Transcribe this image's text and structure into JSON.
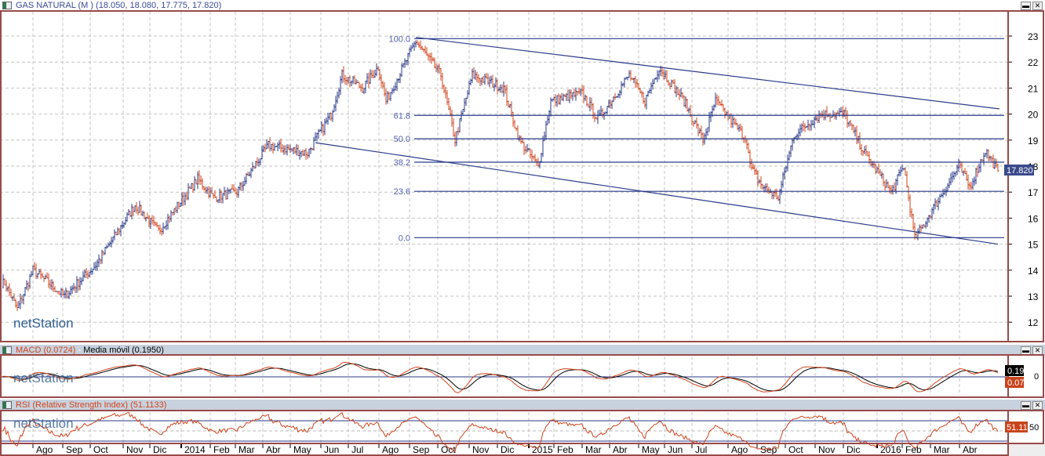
{
  "main": {
    "title": "GAS NATURAL (M ) (18.050, 18.080, 17.775, 17.820)",
    "last_price": "17.820",
    "watermark": "netStation"
  },
  "macd": {
    "title": "MACD (0.0724)",
    "sep": " - ",
    "ma_title": "Media móvil (0.1950)",
    "value1": "0.19",
    "value2": "0.07",
    "axis_label": "0"
  },
  "rsi": {
    "title": "RSI (Relative Strength Index) (51.1133)",
    "value": "51.11",
    "axis_label": "50"
  },
  "window_buttons": {
    "minimize": "▬",
    "close": "✕"
  },
  "colors": {
    "up": "#2a3a8a",
    "down": "#d0441c",
    "line": "#2a3a8a",
    "frame": "#9a4a4a"
  },
  "chart_data": {
    "type": "ohlc",
    "instrument": "GAS NATURAL",
    "last": {
      "open": 18.05,
      "high": 18.08,
      "low": 17.775,
      "close": 17.82
    },
    "ylim": [
      11.6,
      23.5
    ],
    "yticks": [
      12,
      13,
      14,
      15,
      16,
      17,
      18,
      19,
      20,
      21,
      22,
      23
    ],
    "xticks": [
      "Ago",
      "Sep",
      "Oct",
      "Nov",
      "Dic",
      "2014",
      "Feb",
      "Mar",
      "Abr",
      "May",
      "Jun",
      "Jul",
      "Ago",
      "Sep",
      "Oct",
      "Nov",
      "Dic",
      "2015",
      "Feb",
      "Mar",
      "Abr",
      "May",
      "Jun",
      "Jul",
      "Ago",
      "Sep",
      "Oct",
      "Nov",
      "Dic",
      "2016",
      "Feb",
      "Mar",
      "Abr"
    ],
    "price_path_by_bar": [
      [
        2,
        13.5
      ],
      [
        10,
        12.5
      ],
      [
        20,
        14
      ],
      [
        40,
        13
      ],
      [
        60,
        14.2
      ],
      [
        85,
        16.5
      ],
      [
        100,
        15.5
      ],
      [
        125,
        17.5
      ],
      [
        135,
        16.8
      ],
      [
        150,
        17
      ],
      [
        170,
        18.8
      ],
      [
        195,
        18.5
      ],
      [
        210,
        20
      ],
      [
        217,
        21.5
      ],
      [
        230,
        21
      ],
      [
        240,
        21.8
      ],
      [
        245,
        20.5
      ],
      [
        264,
        22.8
      ],
      [
        280,
        21.5
      ],
      [
        289,
        19
      ],
      [
        300,
        21.5
      ],
      [
        320,
        21
      ],
      [
        330,
        19
      ],
      [
        342,
        18
      ],
      [
        350,
        20.5
      ],
      [
        370,
        20.8
      ],
      [
        380,
        19.8
      ],
      [
        400,
        21.5
      ],
      [
        410,
        20.5
      ],
      [
        419,
        21.8
      ],
      [
        435,
        20.5
      ],
      [
        447,
        19
      ],
      [
        455,
        20.5
      ],
      [
        475,
        19
      ],
      [
        477,
        18
      ],
      [
        485,
        17.2
      ],
      [
        495,
        16.8
      ],
      [
        505,
        19.2
      ],
      [
        522,
        20
      ],
      [
        537,
        20
      ],
      [
        550,
        18.5
      ],
      [
        567,
        17
      ],
      [
        575,
        18
      ],
      [
        582,
        15.2
      ],
      [
        592,
        16.2
      ],
      [
        610,
        18
      ],
      [
        617,
        17.2
      ],
      [
        627,
        18.6
      ],
      [
        635,
        17.8
      ]
    ],
    "fibonacci": [
      {
        "level": "100.0",
        "price": 22.9
      },
      {
        "level": "61.8",
        "price": 19.95
      },
      {
        "level": "50.0",
        "price": 19.05
      },
      {
        "level": "38.2",
        "price": 18.15
      },
      {
        "level": "23.6",
        "price": 17.03
      },
      {
        "level": "0.0",
        "price": 15.25
      }
    ],
    "trendlines": [
      {
        "from": [
          264,
          22.95
        ],
        "to": [
          636,
          20.2
        ]
      },
      {
        "from": [
          200,
          18.9
        ],
        "to": [
          635,
          15.0
        ]
      }
    ],
    "indicators": [
      {
        "name": "MACD",
        "value": 0.0724,
        "signal": "Media móvil",
        "signal_value": 0.195
      },
      {
        "name": "RSI",
        "value": 51.1133,
        "levels": [
          30,
          50,
          70
        ]
      }
    ]
  }
}
